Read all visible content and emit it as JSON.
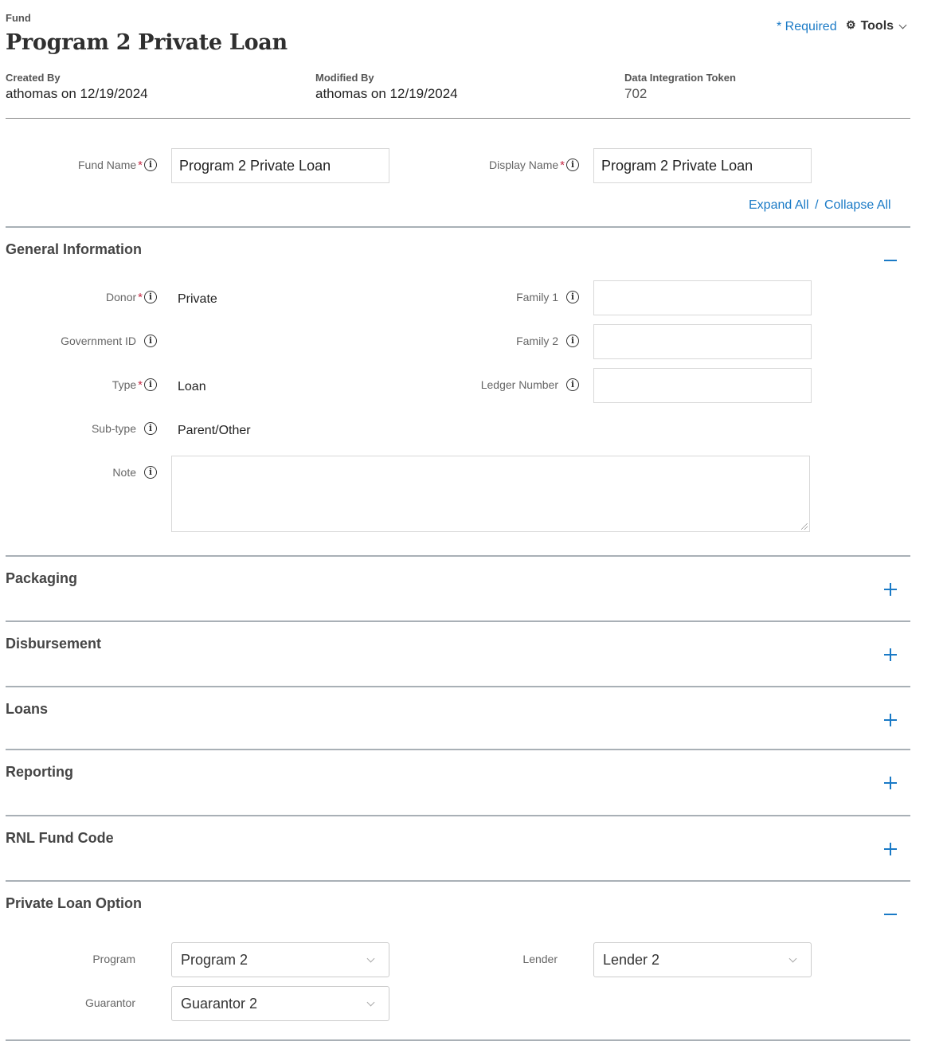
{
  "header": {
    "kicker": "Fund",
    "title": "Program 2 Private Loan",
    "required_link": "* Required",
    "tools_label": "Tools",
    "tools_icon": "gear-icon"
  },
  "meta": {
    "created_by": {
      "label": "Created By",
      "value": "athomas on 12/19/2024"
    },
    "modified_by": {
      "label": "Modified By",
      "value": "athomas on 12/19/2024"
    },
    "token": {
      "label": "Data Integration Token",
      "value": "702"
    }
  },
  "names": {
    "fund_name": {
      "label": "Fund Name",
      "required": "*",
      "value": "Program 2 Private Loan"
    },
    "display_name": {
      "label": "Display Name",
      "required": "*",
      "value": "Program 2 Private Loan"
    }
  },
  "expand_collapse": {
    "expand": "Expand All",
    "separator": "/",
    "collapse": "Collapse All"
  },
  "sections": {
    "general": {
      "title": "General Information",
      "state": "expanded",
      "donor": {
        "label": "Donor",
        "required": "*",
        "value": "Private"
      },
      "government_id": {
        "label": "Government ID",
        "value": ""
      },
      "type": {
        "label": "Type",
        "required": "*",
        "value": "Loan"
      },
      "sub_type": {
        "label": "Sub-type",
        "value": "Parent/Other"
      },
      "note": {
        "label": "Note",
        "value": ""
      },
      "family1": {
        "label": "Family 1",
        "value": ""
      },
      "family2": {
        "label": "Family 2",
        "value": ""
      },
      "ledger_number": {
        "label": "Ledger Number",
        "value": ""
      }
    },
    "packaging": {
      "title": "Packaging",
      "state": "collapsed"
    },
    "disbursement": {
      "title": "Disbursement",
      "state": "collapsed"
    },
    "loans": {
      "title": "Loans",
      "state": "collapsed"
    },
    "reporting": {
      "title": "Reporting",
      "state": "collapsed"
    },
    "rnl_fund_code": {
      "title": "RNL Fund Code",
      "state": "collapsed"
    },
    "private_loan_option": {
      "title": "Private Loan Option",
      "state": "expanded",
      "program": {
        "label": "Program",
        "value": "Program 2"
      },
      "lender": {
        "label": "Lender",
        "value": "Lender 2"
      },
      "guarantor": {
        "label": "Guarantor",
        "value": "Guarantor 2"
      }
    }
  },
  "colors": {
    "accent": "#1a7ac6",
    "required_star": "#c62a45",
    "divider": "#a9b0b6"
  }
}
